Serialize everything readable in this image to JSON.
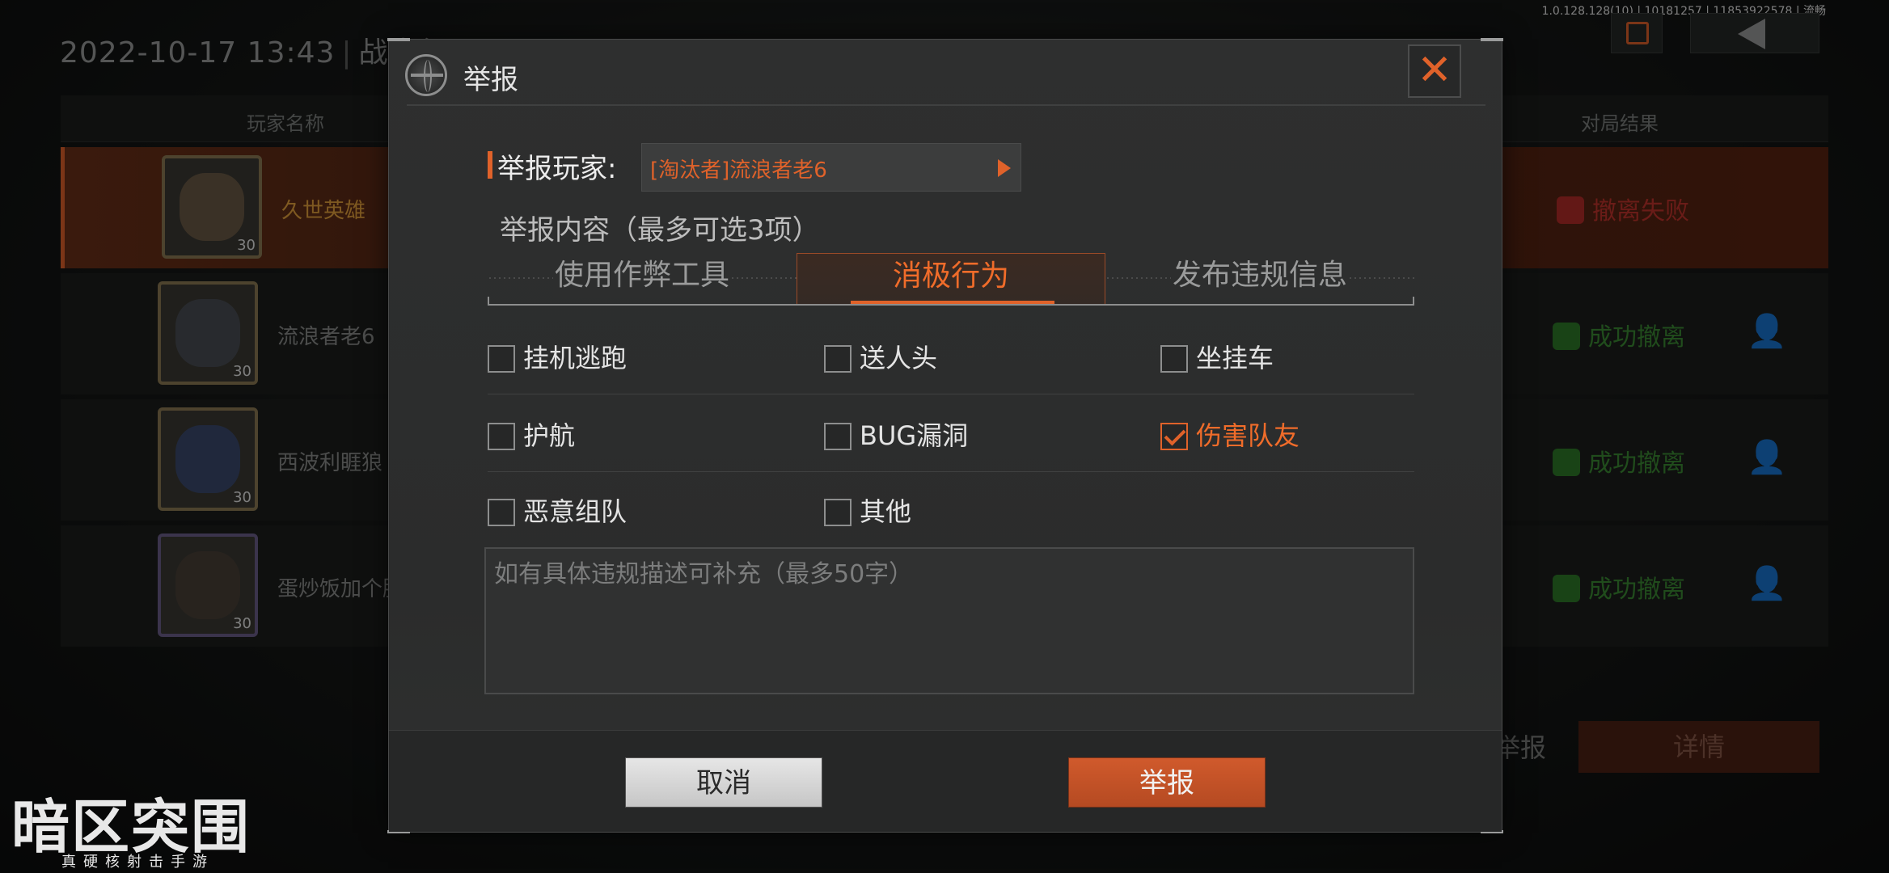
{
  "build_info": "1.0.128.128(10) | 10181257 | 11853922578 | 流畅",
  "background": {
    "datetime": "2022-10-17 13:43",
    "mode_partial": "战术行",
    "columns": [
      "玩家名称",
      "对局结果"
    ],
    "rows": [
      {
        "name": "久世英雄",
        "level": "30",
        "result": "撤离失败",
        "highlight": true
      },
      {
        "name": "流浪者老6",
        "level": "30",
        "result": "成功撤离",
        "highlight": false
      },
      {
        "name": "西波利睚狼",
        "level": "30",
        "result": "成功撤离",
        "highlight": false
      },
      {
        "name": "蛋炒饭加个肠",
        "level": "30",
        "result": "成功撤离",
        "highlight": false
      }
    ],
    "report_link": "举报",
    "detail_button": "详情",
    "add_friend_icon": "add-friend-icon"
  },
  "logo": {
    "main": "暗区突围",
    "sub": "真硬核射击手游"
  },
  "modal": {
    "title": "举报",
    "close_icon": "close-icon",
    "report_player_label": "举报玩家:",
    "report_player_value": "[淘汰者]流浪者老6",
    "content_label": "举报内容（最多可选3项）",
    "tabs": [
      {
        "label": "使用作弊工具",
        "active": false
      },
      {
        "label": "消极行为",
        "active": true
      },
      {
        "label": "发布违规信息",
        "active": false
      }
    ],
    "options": [
      {
        "label": "挂机逃跑",
        "checked": false
      },
      {
        "label": "送人头",
        "checked": false
      },
      {
        "label": "坐挂车",
        "checked": false
      },
      {
        "label": "护航",
        "checked": false
      },
      {
        "label": "BUG漏洞",
        "checked": false
      },
      {
        "label": "伤害队友",
        "checked": true
      },
      {
        "label": "恶意组队",
        "checked": false
      },
      {
        "label": "其他",
        "checked": false
      }
    ],
    "description_placeholder": "如有具体违规描述可补充（最多50字）",
    "cancel_label": "取消",
    "submit_label": "举报"
  },
  "colors": {
    "accent": "#e0622a",
    "success": "#3b8a33",
    "failure": "#c2342c"
  }
}
